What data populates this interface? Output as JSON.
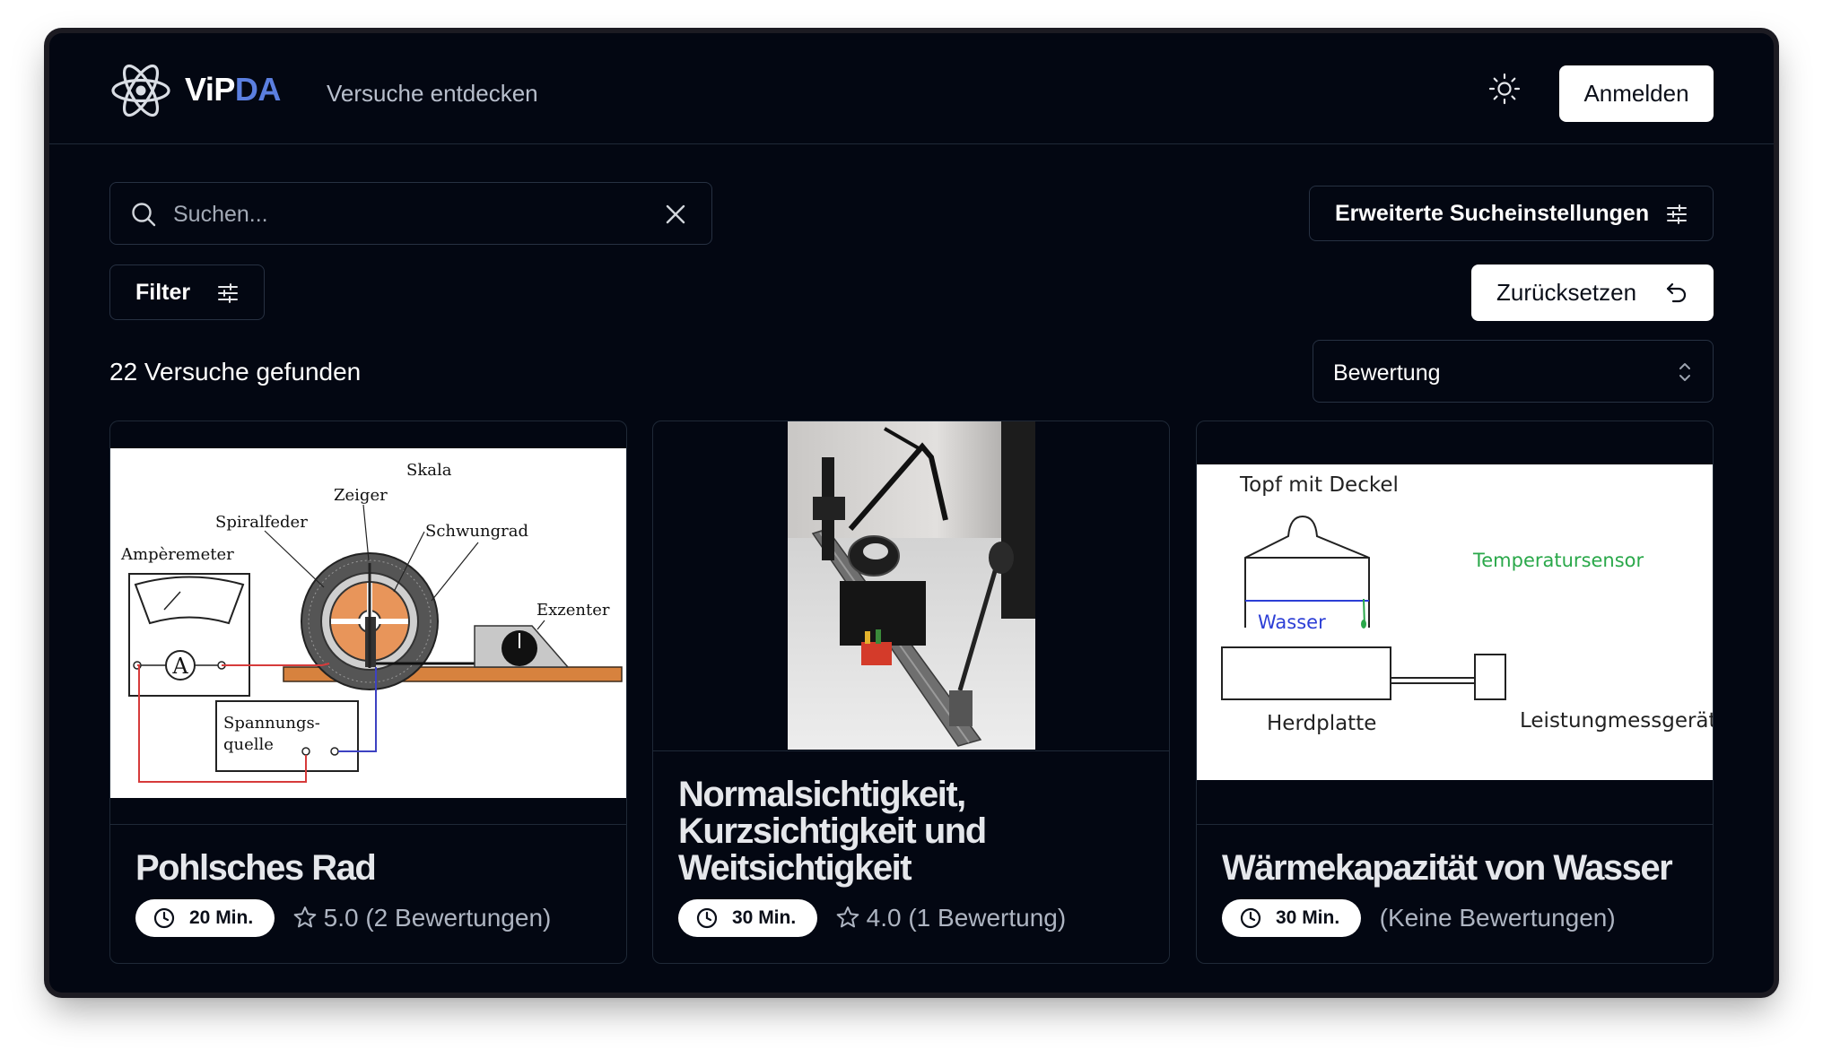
{
  "header": {
    "brand_main": "ViP",
    "brand_accent": "DA",
    "nav_link": "Versuche entdecken",
    "theme_icon": "sun-icon",
    "login_label": "Anmelden"
  },
  "search": {
    "placeholder": "Suchen...",
    "value": "",
    "icon": "search-icon",
    "clear_icon": "close-icon"
  },
  "toolbar": {
    "advanced_label": "Erweiterte Sucheinstellungen",
    "advanced_icon": "sliders-icon",
    "filter_label": "Filter",
    "filter_icon": "sliders-icon",
    "reset_label": "Zurücksetzen",
    "reset_icon": "undo-icon"
  },
  "results": {
    "count_text": "22 Versuche gefunden",
    "sort_value": "Bewertung",
    "sort_icon": "chevron-up-down-icon"
  },
  "colors": {
    "background": "#030712",
    "brand_accent": "#5b7fe0",
    "border": "#1f2937"
  },
  "cards": [
    {
      "title": "Pohlsches Rad",
      "duration": "20 Min.",
      "rating": "5.0 (2 Bewertungen)",
      "diagram": {
        "skala": "Skala",
        "zeiger": "Zeiger",
        "spiralfeder": "Spiralfeder",
        "schwungrad": "Schwungrad",
        "amperemeter": "Ampèremeter",
        "exzenter": "Exzenter",
        "ammeter_symbol": "A",
        "spannung_1": "Spannungs-",
        "spannung_2": "quelle"
      }
    },
    {
      "title": "Normalsichtigkeit, Kurzsichtigkeit und Weitsichtigkeit",
      "duration": "30 Min.",
      "rating": "4.0 (1 Bewertung)"
    },
    {
      "title": "Wärmekapazität von Wasser",
      "duration": "30 Min.",
      "rating": "(Keine Bewertungen)",
      "diagram": {
        "topf": "Topf mit Deckel",
        "sensor": "Temperatursensor",
        "wasser": "Wasser",
        "herdplatte": "Herdplatte",
        "messgeraet": "Leistungmessgerät"
      }
    }
  ]
}
